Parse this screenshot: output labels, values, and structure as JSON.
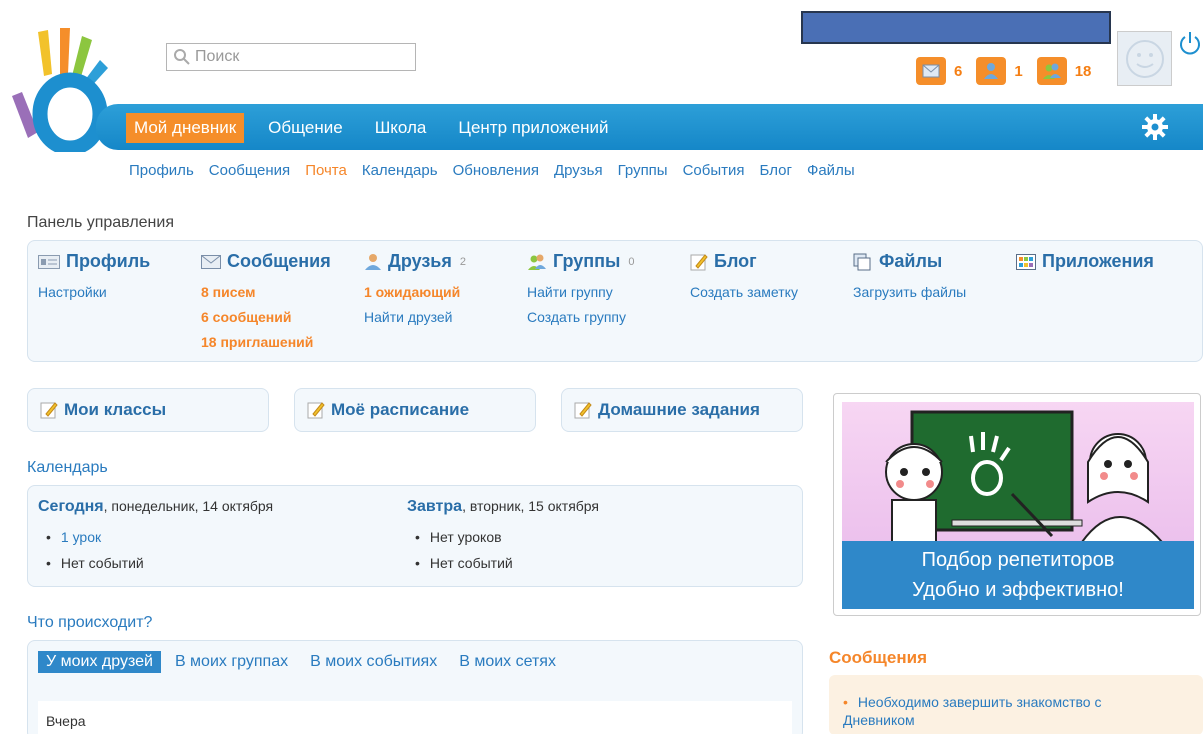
{
  "search": {
    "placeholder": "Поиск"
  },
  "counters": [
    {
      "icon": "mail-icon",
      "value": "6"
    },
    {
      "icon": "person-icon",
      "value": "1"
    },
    {
      "icon": "group-icon",
      "value": "18"
    }
  ],
  "mainnav": {
    "items": [
      "Мой дневник",
      "Общение",
      "Школа",
      "Центр приложений"
    ]
  },
  "subnav": {
    "items": [
      "Профиль",
      "Сообщения",
      "Почта",
      "Календарь",
      "Обновления",
      "Друзья",
      "Группы",
      "События",
      "Блог",
      "Файлы"
    ],
    "active": "Почта"
  },
  "panel": {
    "title": "Панель управления",
    "columns": [
      {
        "title": "Профиль",
        "icon": "profile-card-icon",
        "links": [
          "Настройки"
        ]
      },
      {
        "title": "Сообщения",
        "icon": "envelope-icon",
        "links": [
          "8 писем",
          "6 сообщений",
          "18 приглашений"
        ]
      },
      {
        "title": "Друзья",
        "count": "2",
        "icon": "person-icon",
        "links": [
          "1 ожидающий",
          "Найти друзей"
        ]
      },
      {
        "title": "Группы",
        "count": "0",
        "icon": "group-icon",
        "links": [
          "Найти группу",
          "Создать группу"
        ]
      },
      {
        "title": "Блог",
        "icon": "pencil-icon",
        "links": [
          "Создать заметку"
        ]
      },
      {
        "title": "Файлы",
        "icon": "files-icon",
        "links": [
          "Загрузить файлы"
        ]
      },
      {
        "title": "Приложения",
        "icon": "apps-icon",
        "links": []
      }
    ]
  },
  "quick": [
    "Мои классы",
    "Моё расписание",
    "Домашние задания"
  ],
  "calendar": {
    "title": "Календарь",
    "today": {
      "label": "Сегодня",
      "date": ", понедельник, 14 октября",
      "items": [
        "1 урок",
        "Нет событий"
      ]
    },
    "tomorrow": {
      "label": "Завтра",
      "date": ", вторник, 15 октября",
      "items": [
        "Нет уроков",
        "Нет событий"
      ]
    }
  },
  "ad": {
    "line1": "Подбор репетиторов",
    "line2": "Удобно и эффективно!"
  },
  "whats": {
    "title": "Что происходит?",
    "tabs": [
      "У моих друзей",
      "В моих группах",
      "В моих событиях",
      "В моих сетях"
    ],
    "section": "Вчера"
  },
  "messages": {
    "title": "Сообщения",
    "item": "Необходимо завершить знакомство с Дневником"
  },
  "colors": {
    "brand": "#1d8fcf",
    "accent": "#f58e2a"
  }
}
